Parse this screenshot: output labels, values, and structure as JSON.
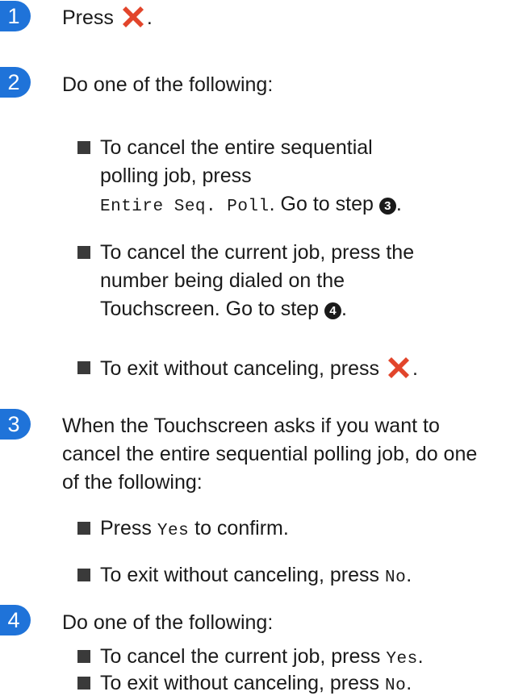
{
  "steps": [
    {
      "number": "1",
      "text_before": "Press",
      "text_after": "."
    },
    {
      "number": "2",
      "text": "Do one of the following:"
    },
    {
      "number": "3",
      "text": "When the Touchscreen asks if you want to cancel the entire sequential polling job, do one of the following:"
    },
    {
      "number": "4",
      "text": "Do one of the following:"
    }
  ],
  "step2_bullets": {
    "b1": {
      "line1": "To cancel the entire sequential",
      "line2": "polling job, press",
      "code": "Entire Seq. Poll",
      "after": ". Go to step",
      "ref": "3",
      "end": "."
    },
    "b2": {
      "line1": "To cancel the current job, press the",
      "line2": "number being dialed on the",
      "line3": "Touchscreen. Go to step",
      "ref": "4",
      "end": "."
    },
    "b3": {
      "text": "To exit without canceling, press",
      "end": "."
    }
  },
  "step3_bullets": {
    "b1": {
      "before": "Press",
      "code": "Yes",
      "after": "to confirm."
    },
    "b2": {
      "before": "To exit without canceling, press",
      "code": "No",
      "end": "."
    }
  },
  "step4_bullets": {
    "b1": {
      "before": "To cancel the current job, press",
      "code": "Yes",
      "end": "."
    },
    "b2": {
      "before": "To exit without canceling, press",
      "code": "No",
      "end": "."
    }
  },
  "icons": {
    "cancel": "cancel-x-icon"
  },
  "colors": {
    "badge": "#1f73d9",
    "cancel_icon": "#e2452b"
  }
}
